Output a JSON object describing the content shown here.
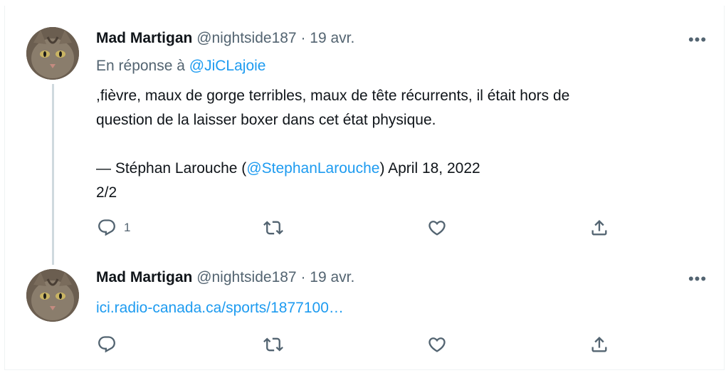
{
  "tweet1": {
    "name": "Mad Martigan",
    "handle": "@nightside187",
    "separator": "·",
    "date": "19 avr.",
    "reply_prefix": "En réponse à",
    "reply_handle": "@JiCLajoie",
    "text_line1": ",fièvre, maux de gorge terribles, maux de tête récurrents, il était hors de",
    "text_line2": "question de la laisser boxer dans cet état physique.",
    "quote_prefix": "— Stéphan Larouche (",
    "quote_handle": "@StephanLarouche",
    "quote_suffix": ") April 18, 2022",
    "thread_count": "2/2",
    "reply_count": "1",
    "more_label": "•••"
  },
  "tweet2": {
    "name": "Mad Martigan",
    "handle": "@nightside187",
    "separator": "·",
    "date": "19 avr.",
    "link_text": "ici.radio-canada.ca/sports/1877100…",
    "more_label": "•••"
  },
  "icons": {
    "reply": "reply-icon",
    "retweet": "retweet-icon",
    "like": "heart-icon",
    "share": "share-icon",
    "more": "more-icon"
  },
  "colors": {
    "link": "#1d9bf0",
    "secondary": "#536471",
    "primary_text": "#0f1419",
    "thread_line": "#cfd9de"
  }
}
